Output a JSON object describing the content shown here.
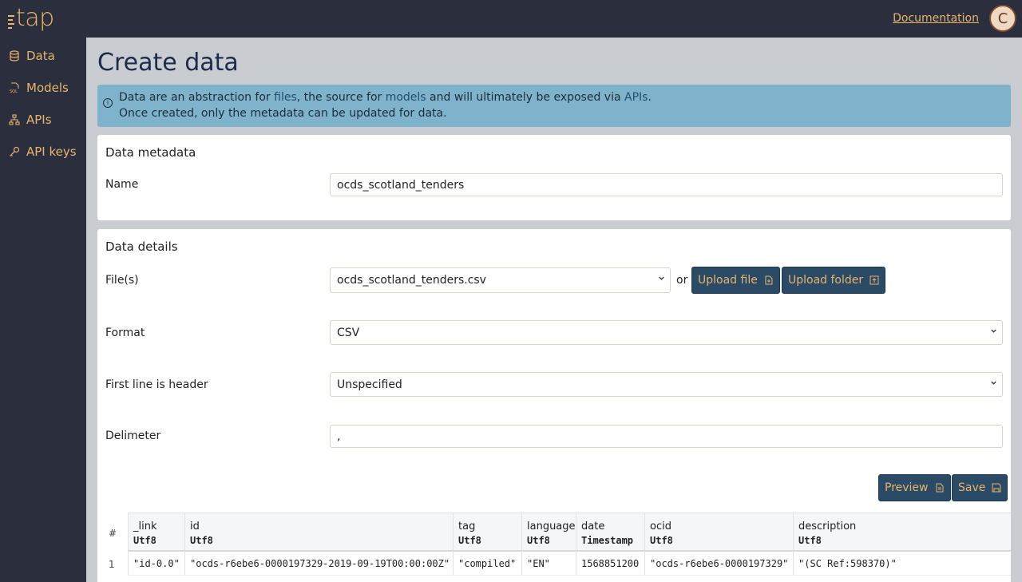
{
  "header": {
    "logo_text": "tap",
    "documentation_link": "Documentation",
    "avatar_initial": "C",
    "accent_color": "#e8b46a",
    "bar_color": "#2b2f3d"
  },
  "sidebar": {
    "items": [
      {
        "label": "Data",
        "icon": "database-icon"
      },
      {
        "label": "Models",
        "icon": "sql-file-icon"
      },
      {
        "label": "APIs",
        "icon": "network-icon"
      },
      {
        "label": "API keys",
        "icon": "key-icon"
      }
    ]
  },
  "main": {
    "title": "Create data",
    "alert": {
      "part1": "Data are an abstraction for ",
      "link_files": "files",
      "part2": ", the source for ",
      "link_models": "models",
      "part3": " and will ultimately be exposed via ",
      "link_apis": "APIs",
      "part4": ".",
      "line2": "Once created, only the metadata can be updated for data."
    },
    "metadata": {
      "title": "Data metadata",
      "name_label": "Name",
      "name_value": "ocds_scotland_tenders"
    },
    "details": {
      "title": "Data details",
      "files_label": "File(s)",
      "files_value": "ocds_scotland_tenders.csv",
      "or_text": "or",
      "upload_file": "Upload file",
      "upload_folder": "Upload folder",
      "format_label": "Format",
      "format_value": "CSV",
      "header_label": "First line is header",
      "header_value": "Unspecified",
      "delimiter_label": "Delimeter",
      "delimiter_value": ",",
      "preview_button": "Preview",
      "save_button": "Save"
    },
    "table": {
      "rownum_header": "#",
      "columns": [
        {
          "name": "_link",
          "type": "Utf8"
        },
        {
          "name": "id",
          "type": "Utf8"
        },
        {
          "name": "tag",
          "type": "Utf8"
        },
        {
          "name": "language",
          "type": "Utf8"
        },
        {
          "name": "date",
          "type": "Timestamp"
        },
        {
          "name": "ocid",
          "type": "Utf8"
        },
        {
          "name": "description",
          "type": "Utf8"
        }
      ],
      "rows": [
        {
          "num": "1",
          "cells": [
            "\"id-0.0\"",
            "\"ocds-r6ebe6-0000197329-2019-09-19T00:00:00Z\"",
            "\"compiled\"",
            "\"EN\"",
            "1568851200",
            "\"ocds-r6ebe6-0000197329\"",
            "\"(SC Ref:598370)\""
          ]
        }
      ]
    }
  }
}
